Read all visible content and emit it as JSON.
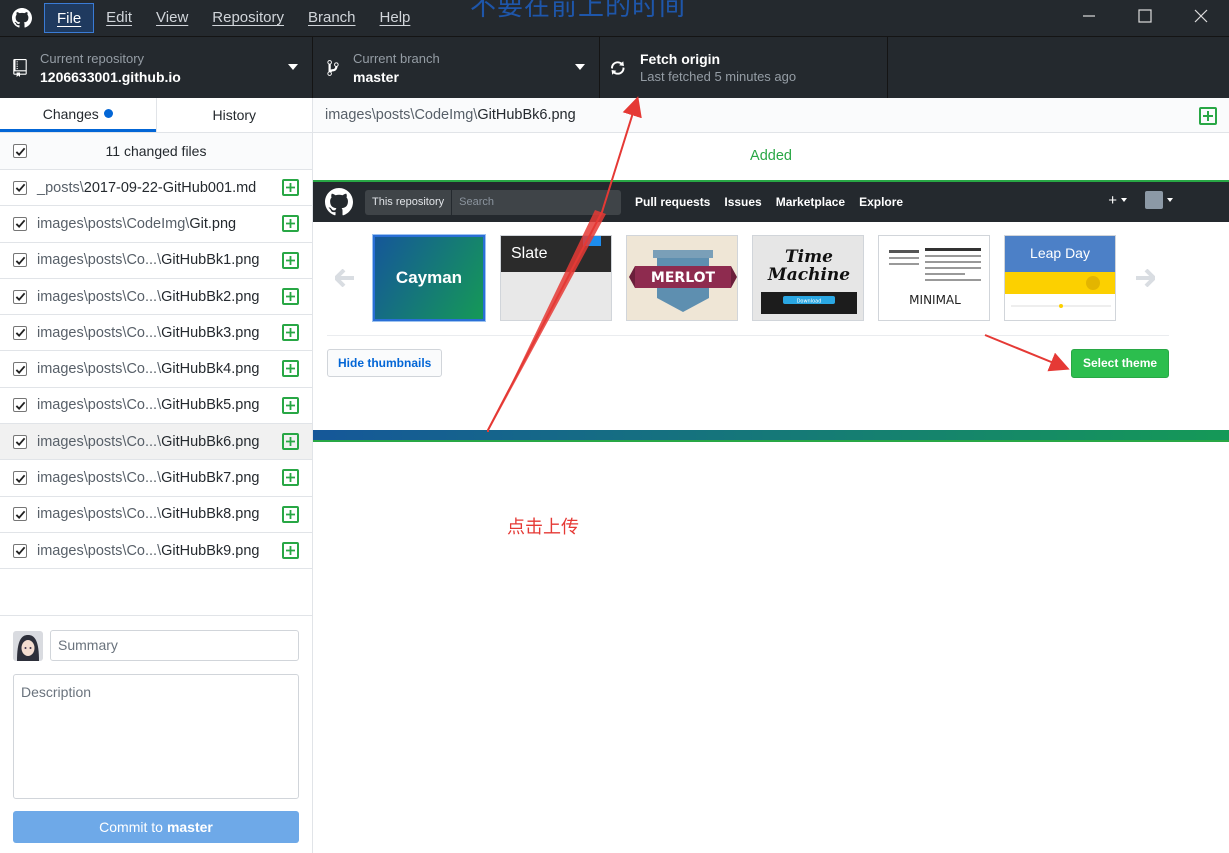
{
  "title_overlay": "不要在前上的时间",
  "menu": [
    {
      "label": "File"
    },
    {
      "label": "Edit"
    },
    {
      "label": "View"
    },
    {
      "label": "Repository"
    },
    {
      "label": "Branch"
    },
    {
      "label": "Help"
    }
  ],
  "toolbar": {
    "repo_label": "Current repository",
    "repo_value": "1206633001.github.io",
    "branch_label": "Current branch",
    "branch_value": "master",
    "fetch_label": "Fetch origin",
    "fetch_sub": "Last fetched 5 minutes ago"
  },
  "tabs": {
    "changes": "Changes",
    "history": "History"
  },
  "changes_header": "11 changed files",
  "files": [
    {
      "dir": "_posts\\",
      "name": "2017-09-22-GitHub001.md"
    },
    {
      "dir": "images\\posts\\CodeImg\\",
      "name": "Git.png"
    },
    {
      "dir": "images\\posts\\Co...\\",
      "name": "GitHubBk1.png"
    },
    {
      "dir": "images\\posts\\Co...\\",
      "name": "GitHubBk2.png"
    },
    {
      "dir": "images\\posts\\Co...\\",
      "name": "GitHubBk3.png"
    },
    {
      "dir": "images\\posts\\Co...\\",
      "name": "GitHubBk4.png"
    },
    {
      "dir": "images\\posts\\Co...\\",
      "name": "GitHubBk5.png"
    },
    {
      "dir": "images\\posts\\Co...\\",
      "name": "GitHubBk6.png"
    },
    {
      "dir": "images\\posts\\Co...\\",
      "name": "GitHubBk7.png"
    },
    {
      "dir": "images\\posts\\Co...\\",
      "name": "GitHubBk8.png"
    },
    {
      "dir": "images\\posts\\Co...\\",
      "name": "GitHubBk9.png"
    }
  ],
  "selected_file_index": 7,
  "commit": {
    "summary_placeholder": "Summary",
    "description_placeholder": "Description",
    "button_prefix": "Commit to",
    "button_branch": "master"
  },
  "diff": {
    "path_dir": "images\\posts\\CodeImg\\",
    "path_file": "GitHubBk6.png",
    "status": "Added"
  },
  "screenshot": {
    "scope": "This repository",
    "search_placeholder": "Search",
    "nav": [
      "Pull requests",
      "Issues",
      "Marketplace",
      "Explore"
    ],
    "plus": "+",
    "themes": {
      "cayman": "Cayman",
      "slate": "Slate",
      "merlot": "MERLOT",
      "time_machine_1": "Time",
      "time_machine_2": "Machine",
      "time_download": "Download",
      "minimal": "MINIMAL",
      "leap_day": "Leap Day"
    },
    "hide_thumbnails": "Hide thumbnails",
    "select_theme": "Select theme"
  },
  "annotation": "点击上传",
  "colors": {
    "titlebar": "#24292e",
    "accent_blue": "#0366d6",
    "added_green": "#28a745",
    "commit_button": "#6ea9e8",
    "annotation_red": "#e53935"
  }
}
